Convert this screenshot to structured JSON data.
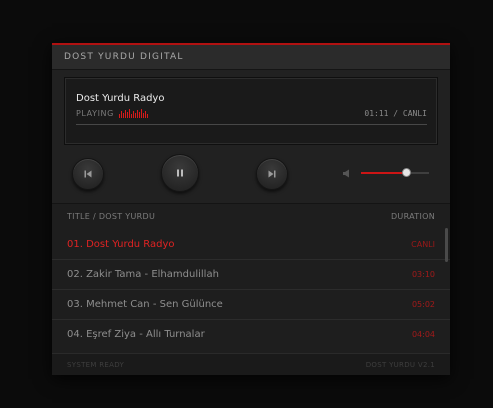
{
  "header": {
    "title": "DOST YURDU DIGITAL"
  },
  "now_playing": {
    "title": "Dost Yurdu Radyo",
    "status": "PLAYING",
    "time": "01:11 / CANLI",
    "progress": 0
  },
  "controls": {
    "prev_icon": "skip-previous-icon",
    "play_pause_icon": "pause-icon",
    "next_icon": "skip-next-icon",
    "volume_icon": "volume-icon",
    "volume_level": 0.66
  },
  "playlist": {
    "header_title": "TITLE / DOST YURDU",
    "header_duration": "DURATION",
    "items": [
      {
        "name": "01. Dost Yurdu Radyo",
        "duration": "CANLI",
        "active": true
      },
      {
        "name": "02. Zakir Tama - Elhamdulillah",
        "duration": "03:10",
        "active": false
      },
      {
        "name": "03. Mehmet Can - Sen Gülünce",
        "duration": "05:02",
        "active": false
      },
      {
        "name": "04. Eşref Ziya - Allı Turnalar",
        "duration": "04:04",
        "active": false
      }
    ]
  },
  "footer": {
    "status": "SYSTEM READY",
    "version": "DOST YURDU V2.1"
  },
  "colors": {
    "accent": "#d51a1a",
    "background": "#0b0b0b",
    "panel": "#212121"
  }
}
